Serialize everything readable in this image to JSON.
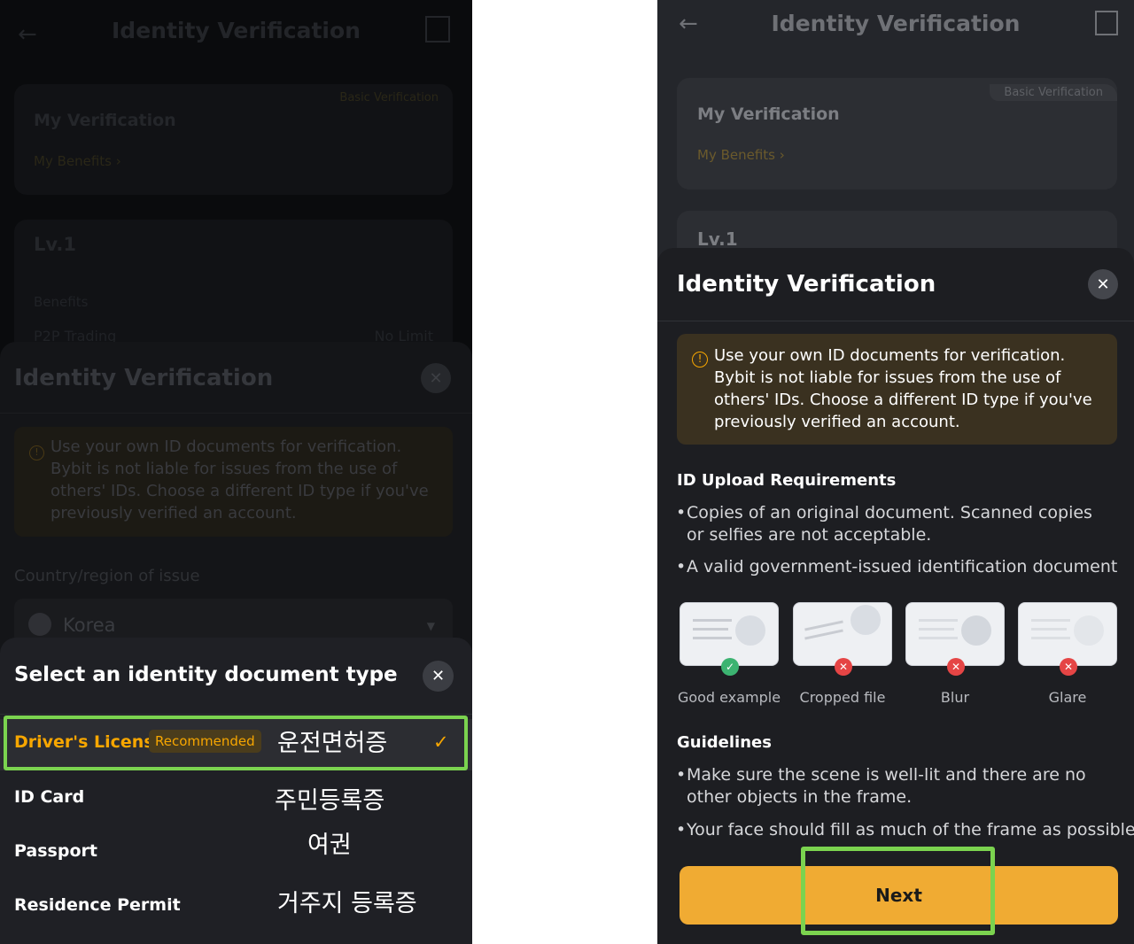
{
  "left": {
    "header_title": "Identity Verification",
    "verification_card": {
      "title": "My Verification",
      "badge": "Basic Verification",
      "benefits_link": "My Benefits"
    },
    "level_card": {
      "level": "Lv.1",
      "benefits_label": "Benefits",
      "row_label": "P2P Trading",
      "row_value": "No Limit"
    },
    "sheet1": {
      "title": "Identity Verification",
      "warning": "Use your own ID documents for verification. Bybit is not liable for issues from the use of others' IDs. Choose a different ID type if you've previously verified an account.",
      "country_label": "Country/region of issue",
      "country_value": "Korea"
    },
    "sheet2": {
      "title": "Select an identity document type",
      "options": [
        {
          "label": "Driver's License",
          "tag": "Recommended",
          "korean": "운전면허증",
          "selected": true
        },
        {
          "label": "ID Card",
          "korean": "주민등록증"
        },
        {
          "label": "Passport",
          "korean": "여권"
        },
        {
          "label": "Residence Permit",
          "korean": "거주지 등록증"
        }
      ]
    }
  },
  "right": {
    "header_title": "Identity Verification",
    "verification_card": {
      "title": "My Verification",
      "badge": "Basic Verification",
      "benefits_link": "My Benefits"
    },
    "level": "Lv.1",
    "sheet": {
      "title": "Identity Verification",
      "warning": "Use your own ID documents for verification. Bybit is not liable for issues from the use of others' IDs. Choose a different ID type if you've previously verified an account.",
      "requirements_title": "ID Upload Requirements",
      "requirements": [
        "Copies of an original document. Scanned copies or selfies are not acceptable.",
        "A valid government-issued identification document"
      ],
      "examples": [
        "Good example",
        "Cropped file",
        "Blur",
        "Glare"
      ],
      "guidelines_title": "Guidelines",
      "guidelines": [
        "Make sure the scene is well-lit and there are no other objects in the frame.",
        "Your face should fill as much of the frame as possible."
      ],
      "next_label": "Next"
    }
  },
  "colors": {
    "accent": "#f7a600",
    "highlight": "#7bd34f",
    "good": "#3cb371",
    "bad": "#e54545"
  }
}
